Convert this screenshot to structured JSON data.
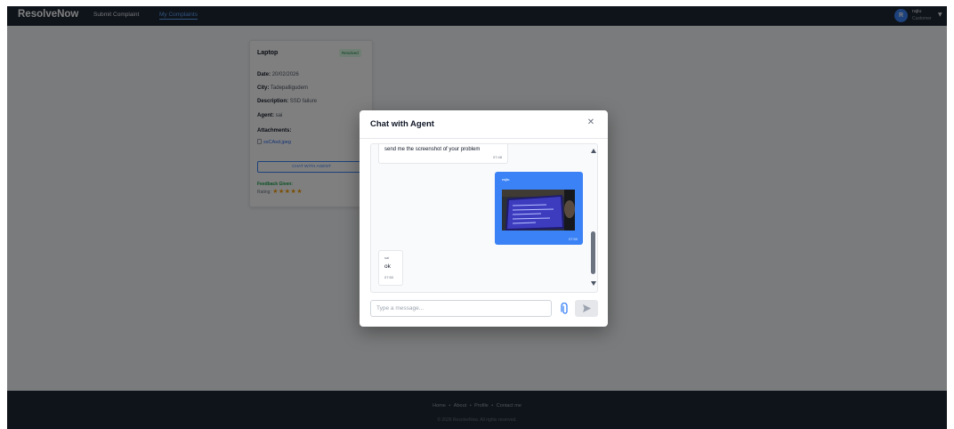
{
  "navbar": {
    "brand": "ResolveNow",
    "links": [
      "Submit Complaint",
      "My Complaints"
    ],
    "user": {
      "avatar_letter": "R",
      "name": "rajiu",
      "role": "Customer"
    }
  },
  "complaint_card": {
    "title": "Laptop",
    "status": "Resolved",
    "date_label": "Date:",
    "date": "20/02/2026",
    "city_label": "City:",
    "city": "Tadepalligudem",
    "description_label": "Description:",
    "description": "SSD failure",
    "agent_label": "Agent:",
    "agent": "sai",
    "attachments_label": "Attachments:",
    "attachment_file": "ssCAsd.jpeg",
    "chat_button": "CHAT WITH AGENT",
    "feedback_label": "Feedback Given:",
    "rating_label": "Rating:",
    "rating": 5,
    "stars": "★★★★★"
  },
  "chat_modal": {
    "title": "Chat with Agent",
    "messages": [
      {
        "from": "agent",
        "text": "send me the screenshot of your problem",
        "time": "07:48"
      },
      {
        "from": "user",
        "sender": "rajiu",
        "time": "07:50",
        "has_image": true
      },
      {
        "from": "agent",
        "sender": "sai",
        "text": "ok",
        "time": "07:50"
      }
    ],
    "input_placeholder": "Type a message..."
  },
  "footer": {
    "links": [
      "Home",
      "About",
      "Profile",
      "Contact me"
    ],
    "separator": "•",
    "copyright": "© 2026 ResolveNow. All rights reserved."
  },
  "colors": {
    "navbar_bg": "#1f2937",
    "accent": "#3b82f6",
    "resolved_badge": "#15803d",
    "star": "#f59e0b"
  }
}
